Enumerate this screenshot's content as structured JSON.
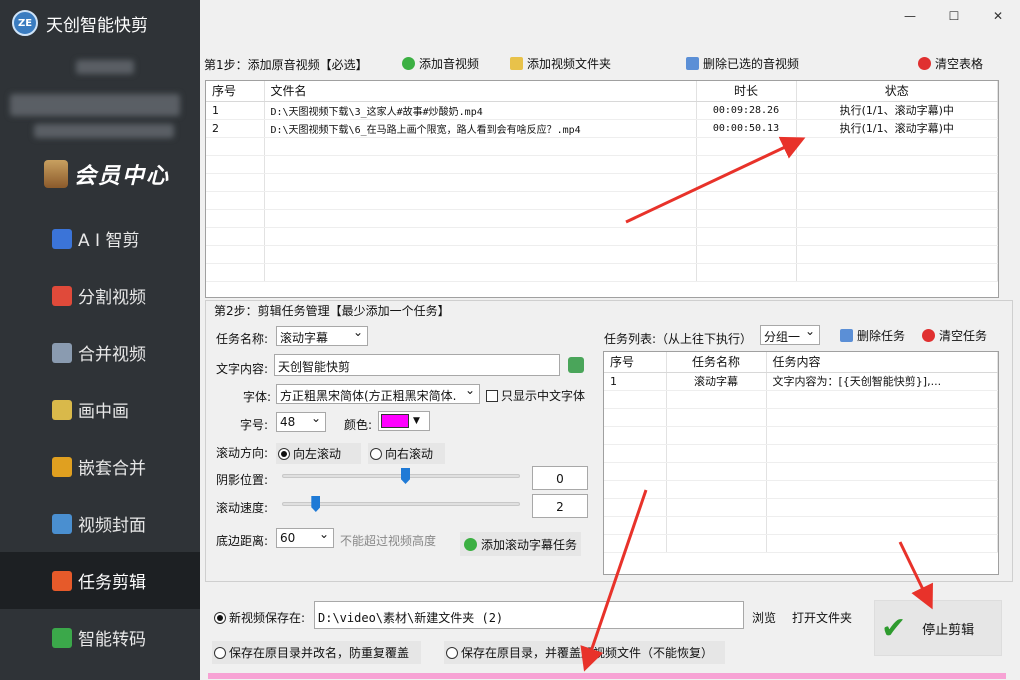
{
  "app": {
    "logo_text": "ZE",
    "title": "天创智能快剪"
  },
  "window_controls": {
    "minimize": "—",
    "maximize": "☐",
    "close": "✕"
  },
  "sidebar": {
    "member_label": "会员中心",
    "items": [
      {
        "label": "A I 智剪",
        "icon": "ai-icon",
        "color": "#3b74d8"
      },
      {
        "label": "分割视频",
        "icon": "split-icon",
        "color": "#e04a3a"
      },
      {
        "label": "合并视频",
        "icon": "merge-icon",
        "color": "#8a9bb0"
      },
      {
        "label": "画中画",
        "icon": "pip-icon",
        "color": "#d9b94a"
      },
      {
        "label": "嵌套合并",
        "icon": "nest-icon",
        "color": "#e0a020"
      },
      {
        "label": "视频封面",
        "icon": "cover-icon",
        "color": "#4a8fd0"
      },
      {
        "label": "任务剪辑",
        "icon": "flower-icon",
        "color": "#e65a2a",
        "active": true
      },
      {
        "label": "智能转码",
        "icon": "transcode-icon",
        "color": "#3ba84a"
      }
    ]
  },
  "step1": {
    "label": "第1步：添加原音视频【必选】",
    "add_video": "添加音视频",
    "add_folder": "添加视频文件夹",
    "delete_selected": "删除已选的音视频",
    "clear_table": "清空表格",
    "columns": [
      "序号",
      "文件名",
      "时长",
      "状态"
    ],
    "rows": [
      {
        "no": "1",
        "file": "D:\\天图视频下载\\3_这家人#故事#炒酸奶.mp4",
        "duration": "00:09:28.26",
        "status": "执行(1/1、滚动字幕)中"
      },
      {
        "no": "2",
        "file": "D:\\天图视频下载\\6_在马路上画个限宽，路人看到会有啥反应？.mp4",
        "duration": "00:00:50.13",
        "status": "执行(1/1、滚动字幕)中"
      }
    ]
  },
  "step2": {
    "label": "第2步：剪辑任务管理【最少添加一个任务】",
    "task_name_label": "任务名称:",
    "task_name_value": "滚动字幕",
    "text_content_label": "文字内容:",
    "text_content_value": "天创智能快剪",
    "font_label": "字体:",
    "font_value": "方正粗黑宋简体(方正粗黑宋简体.",
    "only_chinese_label": "只显示中文字体",
    "size_label": "字号:",
    "size_value": "48",
    "color_label": "颜色:",
    "color_value": "#ff00ff",
    "scroll_dir_label": "滚动方向:",
    "scroll_left": "向左滚动",
    "scroll_right": "向右滚动",
    "shadow_label": "阴影位置:",
    "shadow_value": "0",
    "shadow_fraction": 0.5,
    "speed_label": "滚动速度:",
    "speed_value": "2",
    "speed_fraction": 0.12,
    "bottom_label": "底边距离:",
    "bottom_value": "60",
    "bottom_hint": "不能超过视频高度",
    "add_task_button": "添加滚动字幕任务",
    "task_list_label": "任务列表:（从上往下执行）",
    "group_value": "分组一",
    "delete_task": "删除任务",
    "clear_task": "清空任务",
    "task_columns": [
      "序号",
      "任务名称",
      "任务内容"
    ],
    "tasks": [
      {
        "no": "1",
        "name": "滚动字幕",
        "content": "文字内容为：[{天创智能快剪}],..."
      }
    ]
  },
  "output": {
    "save_new_label": "新视频保存在:",
    "save_path": "D:\\video\\素材\\新建文件夹 (2)",
    "browse": "浏览",
    "open_folder": "打开文件夹",
    "option_rename": "保存在原目录并改名，防重复覆盖",
    "option_overwrite": "保存在原目录，并覆盖原视频文件（不能恢复）",
    "stop_button": "停止剪辑",
    "progress_fraction": 1.0
  },
  "colors": {
    "sidebar_bg": "#2f3337",
    "active_bg": "#1d2023",
    "progress": "#f7a2d4",
    "arrow": "#e8322a"
  }
}
